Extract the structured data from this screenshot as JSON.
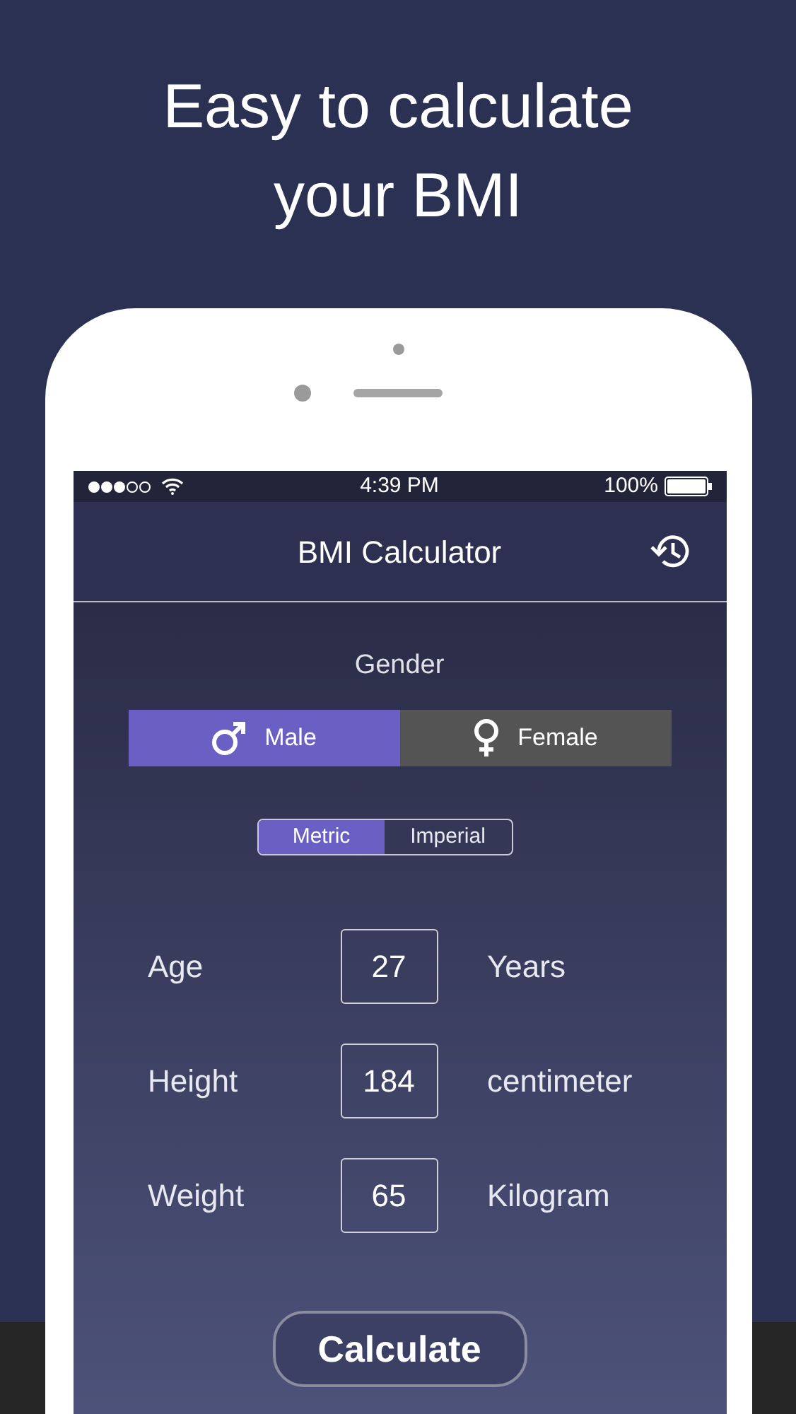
{
  "headline": [
    "Easy to calculate",
    "your BMI"
  ],
  "status_bar": {
    "time": "4:39 PM",
    "battery": "100%"
  },
  "header": {
    "title": "BMI Calculator"
  },
  "gender": {
    "label": "Gender",
    "options": [
      {
        "label": "Male",
        "kind": "male",
        "selected": true
      },
      {
        "label": "Female",
        "kind": "female",
        "selected": false
      }
    ]
  },
  "units": [
    {
      "label": "Metric",
      "selected": true
    },
    {
      "label": "Imperial",
      "selected": false
    }
  ],
  "fields": [
    {
      "label": "Age",
      "value": "27",
      "unit": "Years"
    },
    {
      "label": "Height",
      "value": "184",
      "unit": "centimeter"
    },
    {
      "label": "Weight",
      "value": "65",
      "unit": "Kilogram"
    }
  ],
  "calculate_button": "Calculate"
}
